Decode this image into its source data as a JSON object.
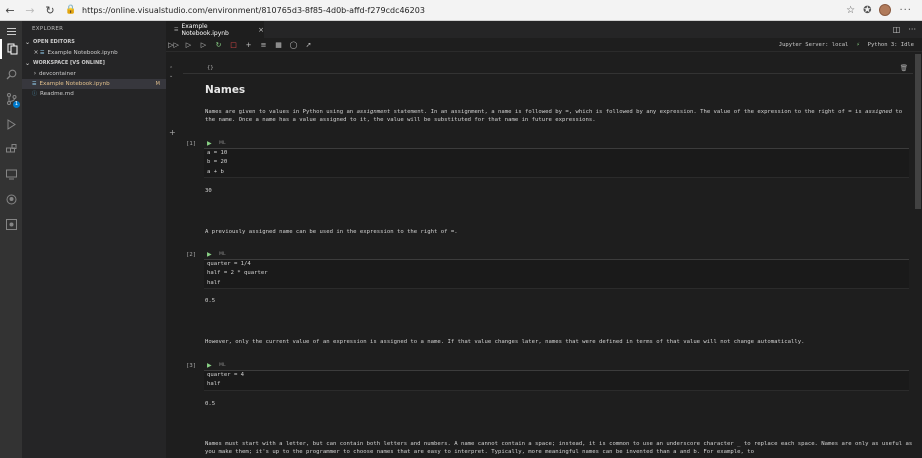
{
  "browser": {
    "url": "https://online.visualstudio.com/environment/810765d3-8f85-4d0b-affd-f279cdc46203"
  },
  "sidebar": {
    "title": "EXPLORER",
    "open_editors_header": "OPEN EDITORS",
    "open_editors": [
      {
        "label": "Example Notebook.ipynb"
      }
    ],
    "workspace_header": "WORKSPACE [VS ONLINE]",
    "workspace_items": [
      {
        "label": "devcontainer"
      },
      {
        "label": "Example Notebook.ipynb",
        "badge": "M"
      },
      {
        "label": "Readme.md"
      }
    ]
  },
  "editor": {
    "tab_label": "Example Notebook.ipynb",
    "kernel_server": "Jupyter Server: local",
    "kernel_lang": "Python 3: Idle"
  },
  "notebook": {
    "markdown_marker": "{}",
    "heading": "Names",
    "intro_parts": [
      "Names are given to values in Python using an ",
      "assignment",
      " statement. In an assignment, a name is followed by =, which is followed by any expression. The value of the expression to the right of = is ",
      "assigned",
      " to the name. Once a name has a value assigned to it, the value will be substituted for that name in future expressions."
    ],
    "cell_meta": "ML",
    "cells": [
      {
        "prompt": "[1]",
        "code": [
          "a = 10",
          "b = 20",
          "a + b"
        ],
        "output": "30"
      },
      {
        "prompt": "[2]",
        "code": [
          "quarter = 1/4",
          "half = 2 * quarter",
          "half"
        ],
        "output": "0.5"
      },
      {
        "prompt": "[3]",
        "code": [
          "quarter = 4",
          "half"
        ],
        "output": "0.5"
      }
    ],
    "text_after_1": "A previously assigned name can be used in the expression to the right of =.",
    "text_after_2": "However, only the current value of an expression is assigned to a name. If that value changes later, names that were defined in terms of that value will not change automatically.",
    "text_after_3": "Names must start with a letter, but can contain both letters and numbers. A name cannot contain a space; instead, it is common to use an underscore character _ to replace each space. Names are only as useful as you make them; it's up to the programmer to choose names that are easy to interpret. Typically, more meaningful names can be invented than a and b. For example, to"
  },
  "colors": {
    "accent": "#007acc",
    "run_green": "#89d185"
  }
}
